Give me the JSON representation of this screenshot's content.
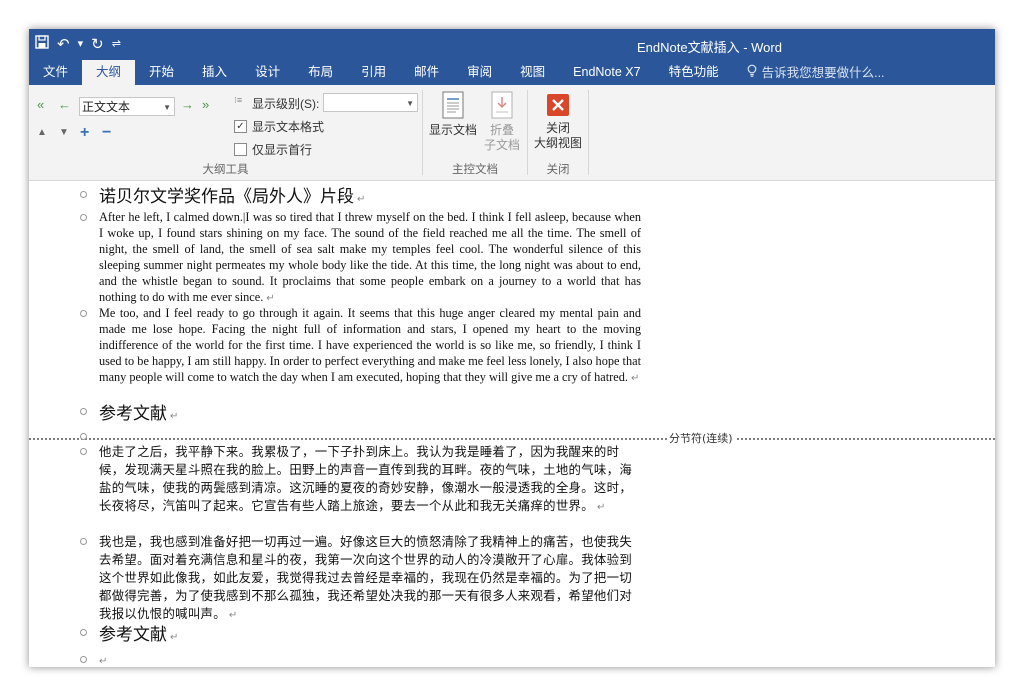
{
  "window": {
    "title": "EndNote文献插入 - Word"
  },
  "qat": {
    "save_icon": "save-icon",
    "undo_icon": "undo-icon",
    "redo_icon": "redo-icon",
    "customize_icon": "customize-icon"
  },
  "ribbon_tabs": [
    {
      "label": "文件"
    },
    {
      "label": "大纲"
    },
    {
      "label": "开始"
    },
    {
      "label": "插入"
    },
    {
      "label": "设计"
    },
    {
      "label": "布局"
    },
    {
      "label": "引用"
    },
    {
      "label": "邮件"
    },
    {
      "label": "审阅"
    },
    {
      "label": "视图"
    },
    {
      "label": "EndNote X7"
    },
    {
      "label": "特色功能"
    }
  ],
  "tell_me": {
    "placeholder": "告诉我您想要做什么..."
  },
  "outline_tools": {
    "group_label": "大纲工具",
    "level_value": "正文文本",
    "show_level_label": "显示级别(S):",
    "show_level_value": "",
    "show_text_format": {
      "label": "显示文本格式",
      "checked": true
    },
    "first_line_only": {
      "label": "仅显示首行",
      "checked": false
    }
  },
  "master_document": {
    "group_label": "主控文档",
    "show_document": "显示文档",
    "collapse_line1": "折叠",
    "collapse_line2": "子文档"
  },
  "close_group": {
    "group_label": "关闭",
    "close_line1": "关闭",
    "close_line2": "大纲视图"
  },
  "document": {
    "heading1": "诺贝尔文学奖作品《局外人》片段",
    "para1": "After he left, I calmed down.|I was so tired that I threw myself on the bed. I think I fell asleep, because when I woke up, I found stars shining on my face. The sound of the field reached me all the time. The smell of night, the smell of land, the smell of sea salt make my temples feel cool. The wonderful silence of this sleeping summer night permeates my whole body like the tide. At this time, the long night was about to end, and the whistle began to sound. It proclaims that some people embark on a journey to a world that has nothing to do with me ever since.",
    "para2": "Me too, and I feel ready to go through it again. It seems that this huge anger cleared my mental pain and made me lose hope. Facing the night full of information and stars, I opened my heart to the moving indifference of the world for the first time. I have experienced the world is so like me, so friendly, I think I used to be happy, I am still happy. In order to perfect everything and make me feel less lonely, I also hope that many people will come to watch the day when I am executed, hoping that they will give me a cry of hatred.",
    "heading2": "参考文献",
    "section_break": "分节符(连续)",
    "para3": "他走了之后，我平静下来。我累极了，一下子扑到床上。我认为我是睡着了，因为我醒来的时候，发现满天星斗照在我的脸上。田野上的声音一直传到我的耳畔。夜的气味，土地的气味，海盐的气味，使我的两鬓感到清凉。这沉睡的夏夜的奇妙安静，像潮水一般浸透我的全身。这时，长夜将尽，汽笛叫了起来。它宣告有些人踏上旅途，要去一个从此和我无关痛痒的世界。",
    "para4": "我也是，我也感到准备好把一切再过一遍。好像这巨大的愤怒清除了我精神上的痛苦，也使我失去希望。面对着充满信息和星斗的夜，我第一次向这个世界的动人的冷漠敞开了心扉。我体验到这个世界如此像我，如此友爱，我觉得我过去曾经是幸福的，我现在仍然是幸福的。为了把一切都做得完善，为了使我感到不那么孤独，我还希望处决我的那一天有很多人来观看，希望他们对我报以仇恨的喊叫声。",
    "heading3": "参考文献",
    "para_mark": "↵"
  },
  "colors": {
    "accent": "#2b579a",
    "ribbon_bg": "#f3f3f3",
    "close_red": "#d9472b"
  }
}
